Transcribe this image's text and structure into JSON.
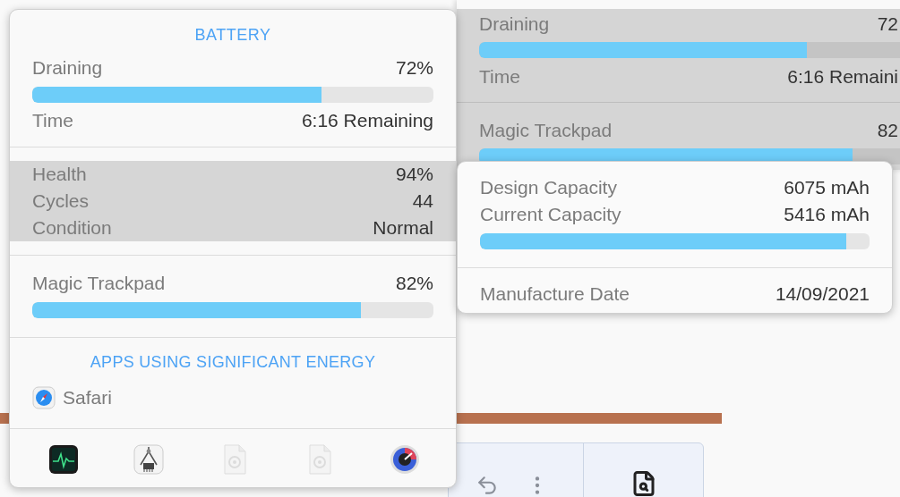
{
  "background_panel": {
    "rows": [
      {
        "kind": "meter",
        "label": "Draining",
        "value": "72",
        "level": 0.72
      },
      {
        "kind": "text",
        "label": "Time",
        "value": "6:16 Remaini"
      },
      {
        "kind": "divider"
      },
      {
        "kind": "meter",
        "label": "Magic Trackpad",
        "value": "82",
        "level": 0.82
      }
    ]
  },
  "battery_popover": {
    "title": "BATTERY",
    "status_rows": [
      {
        "kind": "meter",
        "label": "Draining",
        "value": "72%",
        "level": 0.72
      },
      {
        "kind": "text",
        "label": "Time",
        "value": "6:16 Remaining"
      }
    ],
    "health": {
      "highlighted": true,
      "rows": [
        {
          "label": "Health",
          "value": "94%"
        },
        {
          "label": "Cycles",
          "value": "44"
        },
        {
          "label": "Condition",
          "value": "Normal"
        }
      ]
    },
    "devices": [
      {
        "label": "Magic Trackpad",
        "value": "82%",
        "level": 0.82
      }
    ],
    "apps_heading": "APPS USING SIGNIFICANT ENERGY",
    "apps": [
      {
        "name": "Safari"
      }
    ],
    "dock": [
      {
        "kind": "monitor",
        "disabled": false
      },
      {
        "kind": "caliper",
        "disabled": false
      },
      {
        "kind": "document",
        "disabled": true
      },
      {
        "kind": "document",
        "disabled": true
      },
      {
        "kind": "gauge",
        "disabled": false
      }
    ]
  },
  "capacity_popover": {
    "rows": [
      {
        "kind": "text",
        "label": "Design Capacity",
        "value": "6075 mAh"
      },
      {
        "kind": "text",
        "label": "Current Capacity",
        "value": "5416 mAh"
      },
      {
        "kind": "bar",
        "level": 0.94
      },
      {
        "kind": "divider"
      },
      {
        "kind": "text",
        "label": "Manufacture Date",
        "value": "14/09/2021"
      }
    ]
  }
}
